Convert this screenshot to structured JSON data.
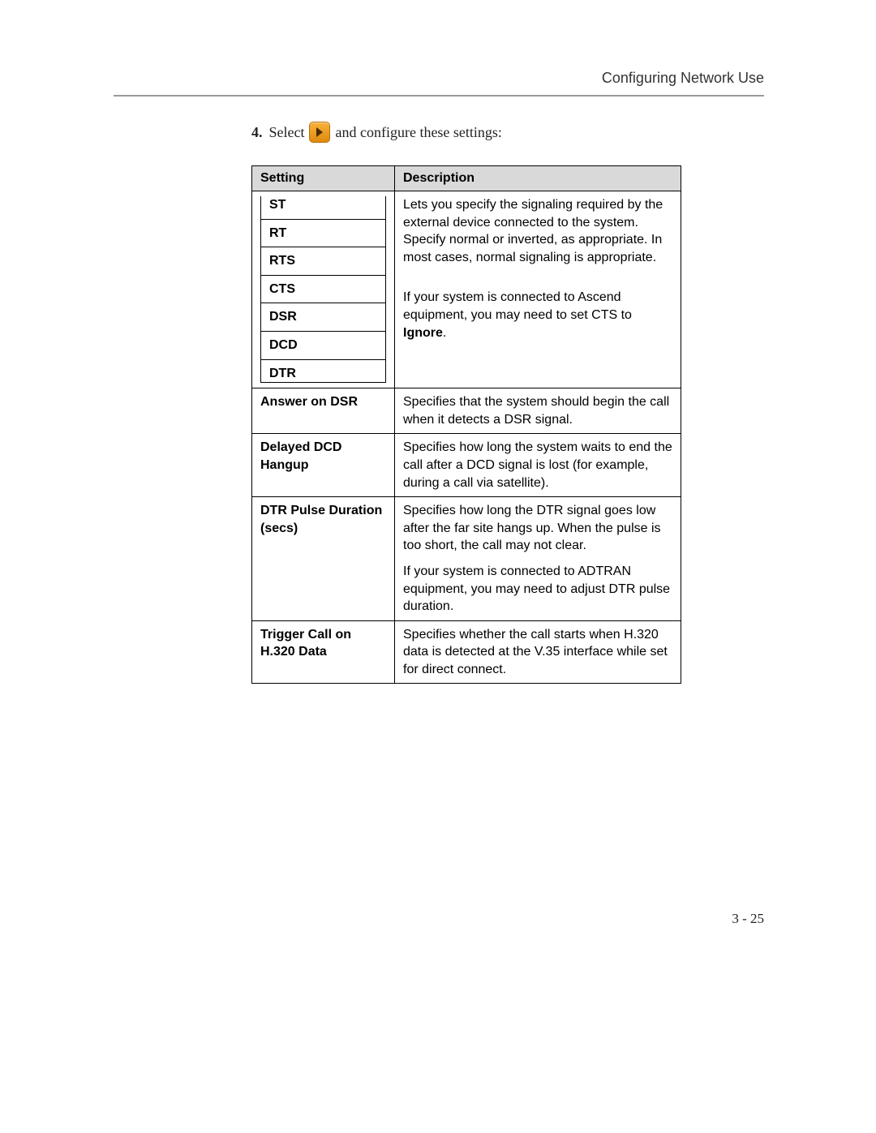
{
  "header": {
    "title": "Configuring Network Use"
  },
  "step": {
    "number": "4.",
    "before": "Select",
    "after": "and configure these settings:"
  },
  "table": {
    "col_setting": "Setting",
    "col_desc": "Description",
    "signals": [
      "ST",
      "RT",
      "RTS",
      "CTS",
      "DSR",
      "DCD",
      "DTR"
    ],
    "signals_desc_p1_a": "Lets you specify the signaling required by the external device connected to the system. Specify normal or inverted, as appropriate. In most cases, normal signaling is appropriate.",
    "signals_desc_p2_a": "If your system is connected to Ascend equipment, you may need to set CTS to ",
    "signals_desc_p2_b": "Ignore",
    "signals_desc_p2_c": ".",
    "rows": {
      "answer_dsr": {
        "label": "Answer on DSR",
        "desc": "Specifies that the system should begin the call when it detects a DSR signal."
      },
      "delayed_dcd": {
        "label": "Delayed DCD Hangup",
        "desc": "Specifies how long the system waits to end the call after a DCD signal is lost (for example, during a call via satellite)."
      },
      "dtr_pulse": {
        "label": "DTR Pulse Duration (secs)",
        "desc_p1": "Specifies how long the DTR signal goes low after the far site hangs up. When the pulse is too short, the call may not clear.",
        "desc_p2": "If your system is connected to ADTRAN equipment, you may need to adjust DTR pulse duration."
      },
      "trigger_h320": {
        "label": "Trigger Call on H.320 Data",
        "desc": "Specifies whether the call starts when H.320 data is detected at the V.35 interface while set for direct connect."
      }
    }
  },
  "footer": {
    "page": "3 - 25"
  }
}
